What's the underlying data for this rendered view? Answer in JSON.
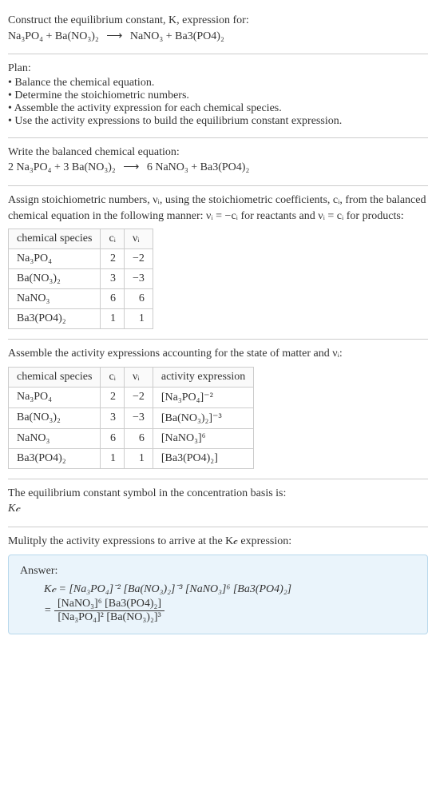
{
  "intro": {
    "line1": "Construct the equilibrium constant, K, expression for:",
    "equation_lhs1": "Na₃PO₄",
    "plus": " + ",
    "equation_lhs2": "Ba(NO₃)₂",
    "arrow": "⟶",
    "equation_rhs1": "NaNO₃",
    "equation_rhs2": "Ba3(PO4)₂"
  },
  "plan": {
    "heading": "Plan:",
    "items": [
      "Balance the chemical equation.",
      "Determine the stoichiometric numbers.",
      "Assemble the activity expression for each chemical species.",
      "Use the activity expressions to build the equilibrium constant expression."
    ]
  },
  "balanced": {
    "heading": "Write the balanced chemical equation:",
    "c1": "2 Na₃PO₄",
    "c2": "3 Ba(NO₃)₂",
    "c3": "6 NaNO₃",
    "c4": "Ba3(PO4)₂"
  },
  "stoich": {
    "text": "Assign stoichiometric numbers, νᵢ, using the stoichiometric coefficients, cᵢ, from the balanced chemical equation in the following manner: νᵢ = −cᵢ for reactants and νᵢ = cᵢ for products:",
    "headers": [
      "chemical species",
      "cᵢ",
      "νᵢ"
    ],
    "rows": [
      [
        "Na₃PO₄",
        "2",
        "−2"
      ],
      [
        "Ba(NO₃)₂",
        "3",
        "−3"
      ],
      [
        "NaNO₃",
        "6",
        "6"
      ],
      [
        "Ba3(PO4)₂",
        "1",
        "1"
      ]
    ]
  },
  "activity": {
    "text": "Assemble the activity expressions accounting for the state of matter and νᵢ:",
    "headers": [
      "chemical species",
      "cᵢ",
      "νᵢ",
      "activity expression"
    ],
    "rows": [
      [
        "Na₃PO₄",
        "2",
        "−2",
        "[Na₃PO₄]⁻²"
      ],
      [
        "Ba(NO₃)₂",
        "3",
        "−3",
        "[Ba(NO₃)₂]⁻³"
      ],
      [
        "NaNO₃",
        "6",
        "6",
        "[NaNO₃]⁶"
      ],
      [
        "Ba3(PO4)₂",
        "1",
        "1",
        "[Ba3(PO4)₂]"
      ]
    ]
  },
  "symbol": {
    "text": "The equilibrium constant symbol in the concentration basis is:",
    "value": "K𝒸"
  },
  "multiply": {
    "text": "Mulitply the activity expressions to arrive at the K𝒸 expression:"
  },
  "answer": {
    "label": "Answer:",
    "line1": "K𝒸 = [Na₃PO₄]⁻² [Ba(NO₃)₂]⁻³ [NaNO₃]⁶ [Ba3(PO4)₂]",
    "eq": "= ",
    "frac_num": "[NaNO₃]⁶ [Ba3(PO4)₂]",
    "frac_den": "[Na₃PO₄]² [Ba(NO₃)₂]³"
  },
  "chart_data": {
    "type": "table",
    "tables": [
      {
        "title": "Stoichiometric numbers",
        "columns": [
          "chemical species",
          "c_i",
          "ν_i"
        ],
        "rows": [
          [
            "Na3PO4",
            2,
            -2
          ],
          [
            "Ba(NO3)2",
            3,
            -3
          ],
          [
            "NaNO3",
            6,
            6
          ],
          [
            "Ba3(PO4)2",
            1,
            1
          ]
        ]
      },
      {
        "title": "Activity expressions",
        "columns": [
          "chemical species",
          "c_i",
          "ν_i",
          "activity expression"
        ],
        "rows": [
          [
            "Na3PO4",
            2,
            -2,
            "[Na3PO4]^-2"
          ],
          [
            "Ba(NO3)2",
            3,
            -3,
            "[Ba(NO3)2]^-3"
          ],
          [
            "NaNO3",
            6,
            6,
            "[NaNO3]^6"
          ],
          [
            "Ba3(PO4)2",
            1,
            1,
            "[Ba3(PO4)2]"
          ]
        ]
      }
    ]
  }
}
